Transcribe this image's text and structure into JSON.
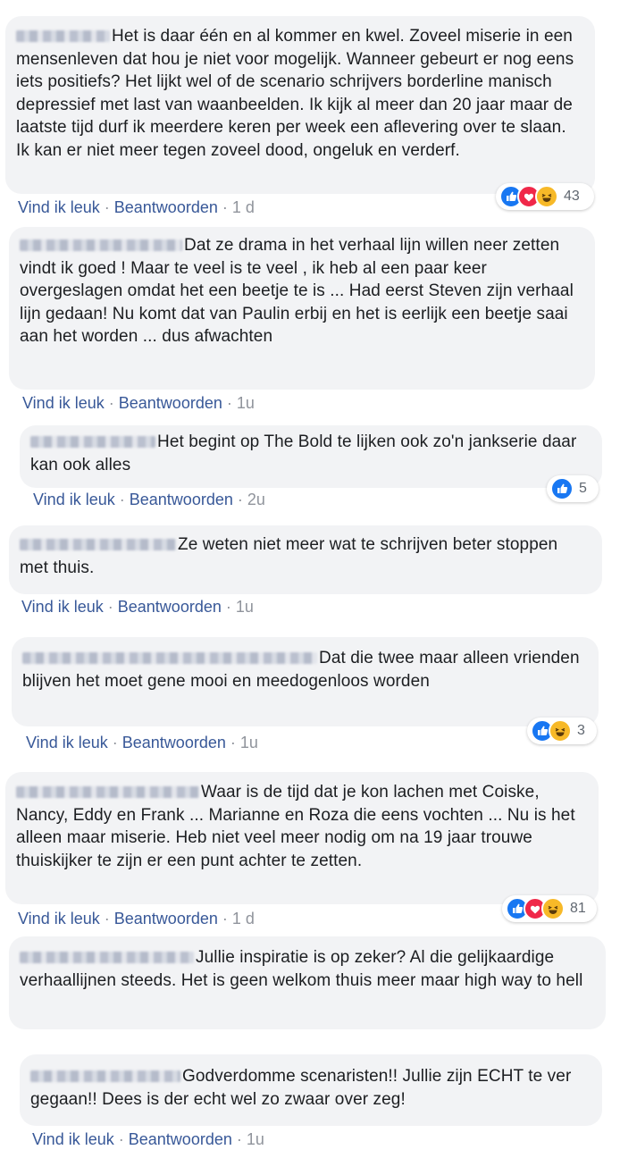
{
  "actions": {
    "like": "Vind ik leuk",
    "reply": "Beantwoorden",
    "separator": "·"
  },
  "colors": {
    "link": "#385898",
    "bubble": "#f2f3f5",
    "like": "#1877f2",
    "love": "#f02849",
    "haha": "#f7b928"
  },
  "comments": [
    {
      "text": "Het is daar één en al kommer en kwel. Zoveel miserie in een mensenleven dat hou je niet voor mogelijk. Wanneer gebeurt er nog eens iets positiefs? Het lijkt wel of de scenario schrijvers borderline manisch depressief met last van waanbeelden. Ik kijk al meer dan 20 jaar maar de laatste tijd durf ik meerdere keren per week een aflevering over te slaan. Ik kan er niet meer tegen zoveel dood, ongeluk en verderf.",
      "time": "1 d",
      "reactions": [
        "like",
        "love",
        "haha"
      ],
      "reaction_count": "43"
    },
    {
      "text": "Dat ze drama in het verhaal lijn willen neer zetten vindt ik goed ! Maar te veel is te veel , ik heb al een paar keer overgeslagen omdat het een beetje te is ... Had eerst Steven zijn verhaal lijn gedaan! Nu komt dat van Paulin erbij en het is eerlijk een beetje saai aan het worden ... dus afwachten",
      "time": "1u"
    },
    {
      "text": "Het begint op The Bold te lijken ook zo'n jankserie daar kan ook alles",
      "time": "2u",
      "reactions": [
        "like"
      ],
      "reaction_count": "5"
    },
    {
      "text": "Ze weten niet meer wat te schrijven beter stoppen met thuis.",
      "time": "1u"
    },
    {
      "text": "Dat die twee maar alleen vrienden blijven het moet gene mooi en meedogenloos worden",
      "time": "1u",
      "reactions": [
        "like",
        "haha"
      ],
      "reaction_count": "3"
    },
    {
      "text": "Waar is de tijd dat je kon lachen met Coiske, Nancy, Eddy en Frank ... Marianne en Roza die eens vochten ... Nu is het alleen maar miserie. Heb niet veel meer nodig om na 19 jaar trouwe thuiskijker te zijn er een punt achter te zetten.",
      "time": "1 d",
      "reactions": [
        "like",
        "love",
        "haha"
      ],
      "reaction_count": "81"
    },
    {
      "text": "Jullie inspiratie is op zeker? Al die gelijkaardige verhaallijnen steeds. Het is geen welkom thuis meer maar high way to hell"
    },
    {
      "text": "Godverdomme scenaristen!! Jullie zijn ECHT te ver gegaan!! Dees is der echt wel zo zwaar over zeg!",
      "time": "1u"
    }
  ]
}
